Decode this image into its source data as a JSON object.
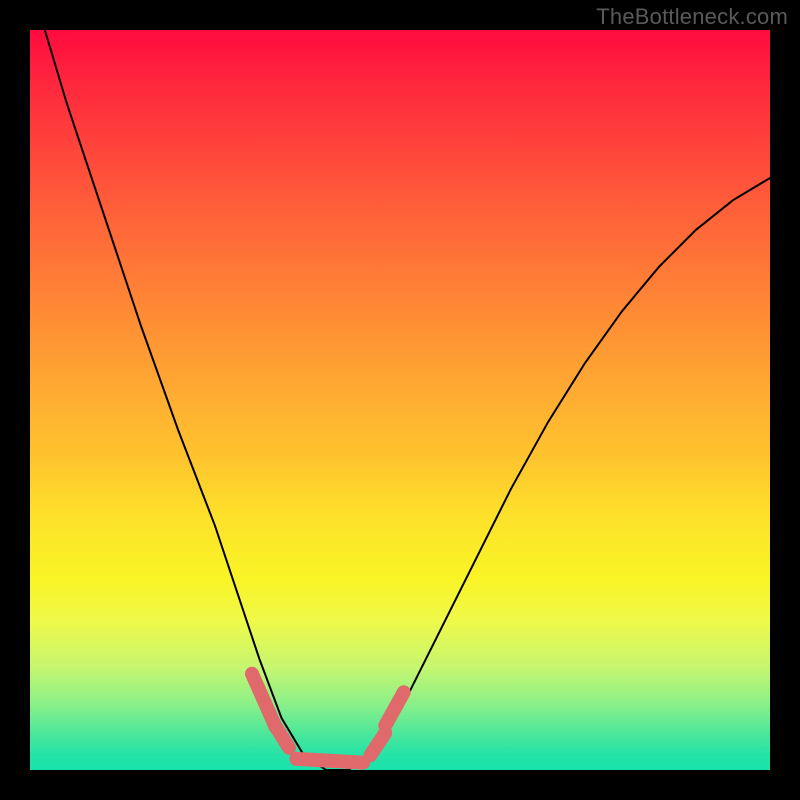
{
  "watermark": "TheBottleneck.com",
  "chart_data": {
    "type": "line",
    "title": "",
    "xlabel": "",
    "ylabel": "",
    "xlim": [
      0,
      1
    ],
    "ylim": [
      0,
      1
    ],
    "series": [
      {
        "name": "curve",
        "x": [
          0.02,
          0.05,
          0.1,
          0.15,
          0.2,
          0.25,
          0.28,
          0.31,
          0.34,
          0.37,
          0.4,
          0.43,
          0.46,
          0.5,
          0.55,
          0.6,
          0.65,
          0.7,
          0.75,
          0.8,
          0.85,
          0.9,
          0.95,
          1.0
        ],
        "y": [
          1.0,
          0.9,
          0.75,
          0.6,
          0.46,
          0.33,
          0.24,
          0.15,
          0.07,
          0.02,
          0.0,
          0.0,
          0.02,
          0.08,
          0.18,
          0.28,
          0.38,
          0.47,
          0.55,
          0.62,
          0.68,
          0.73,
          0.77,
          0.8
        ]
      }
    ],
    "markers": {
      "color": "#e06a6b",
      "segments": [
        {
          "x": [
            0.3,
            0.332
          ],
          "y": [
            0.13,
            0.058
          ]
        },
        {
          "x": [
            0.33,
            0.35
          ],
          "y": [
            0.062,
            0.03
          ]
        },
        {
          "x": [
            0.36,
            0.45
          ],
          "y": [
            0.015,
            0.01
          ]
        },
        {
          "x": [
            0.46,
            0.48
          ],
          "y": [
            0.02,
            0.05
          ]
        },
        {
          "x": [
            0.48,
            0.505
          ],
          "y": [
            0.06,
            0.105
          ]
        }
      ]
    },
    "background_gradient": {
      "top": "#ff0b3f",
      "mid": "#ffd82a",
      "bottom": "#1ae2ac"
    }
  }
}
